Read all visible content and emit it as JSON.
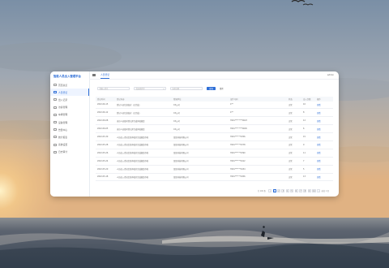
{
  "colors": {
    "accent": "#2f6fd7",
    "sky_top": "#7f94ab",
    "sky_glow": "#e7b47e",
    "sea": "#3a4a5a"
  },
  "app": {
    "logo": "智能人员出入管理平台",
    "user": "admin"
  },
  "sidebar": {
    "items": [
      {
        "label": "首页总览",
        "icon": "home-icon"
      },
      {
        "label": "人员登记",
        "icon": "user-icon"
      },
      {
        "label": "出入记录",
        "icon": "door-icon"
      },
      {
        "label": "访客管理",
        "icon": "visitor-icon"
      },
      {
        "label": "车辆管理",
        "icon": "car-icon"
      },
      {
        "label": "设备管理",
        "icon": "device-icon"
      },
      {
        "label": "告警中心",
        "icon": "alarm-icon"
      },
      {
        "label": "统计报表",
        "icon": "chart-icon"
      },
      {
        "label": "系统设置",
        "icon": "gear-icon"
      },
      {
        "label": "日志审计",
        "icon": "log-icon"
      }
    ],
    "active_index": 1
  },
  "header": {
    "tab": "人员登记"
  },
  "filters": {
    "name_placeholder": "请输入姓名",
    "type_placeholder": "请选择类型",
    "date_placeholder": "选择日期",
    "search_label": "查询",
    "reset_label": "重置"
  },
  "table": {
    "columns": [
      "登记时间",
      "登记内容",
      "所属单位",
      "证件号码",
      "状态",
      "出入次数",
      "操作"
    ],
    "rows": [
      [
        "2022-06-15",
        "登记人员信息核对（已完成）",
        "XX公司",
        "4**",
        "正常",
        "10",
        "查看"
      ],
      [
        "2022-06-12",
        "登记人员信息核对（已完成）",
        "XX公司",
        "4**",
        "正常",
        "8",
        "查看"
      ],
      [
        "2022-06-08",
        "来访人员临时登记并完成审核备案",
        "XX公司",
        "3501********0023",
        "正常",
        "12",
        "查看"
      ],
      [
        "2022-06-05",
        "来访人员临时登记并完成审核备案",
        "XX公司",
        "3501********0045",
        "正常",
        "6",
        "查看"
      ],
      [
        "2022-05-30",
        "人员出入登记信息审核并完成备案存档",
        "某某科技有限公司",
        "3501******2356",
        "正常",
        "15",
        "查看"
      ],
      [
        "2022-05-28",
        "人员出入登记信息审核并完成备案存档",
        "某某科技有限公司",
        "3501******2378",
        "正常",
        "9",
        "查看"
      ],
      [
        "2022-05-26",
        "人员出入登记信息审核并完成备案存档",
        "某某科技有限公司",
        "3501******2390",
        "正常",
        "11",
        "查看"
      ],
      [
        "2022-05-24",
        "人员出入登记信息审核并完成备案存档",
        "某某科技有限公司",
        "3501******2412",
        "正常",
        "7",
        "查看"
      ],
      [
        "2022-05-20",
        "人员出入登记信息审核并完成备案存档",
        "某某科技有限公司",
        "3501******2434",
        "正常",
        "5",
        "查看"
      ],
      [
        "2022-05-18",
        "人员出入登记信息审核并完成备案存档",
        "某某科技有限公司",
        "3501******2456",
        "正常",
        "13",
        "查看"
      ]
    ]
  },
  "pagination": {
    "total": "共 100 条",
    "prev": "‹",
    "pages": [
      "1",
      "2",
      "3",
      "4",
      "5",
      "6",
      "7",
      "8",
      "9",
      "10"
    ],
    "next": "›",
    "active": 0,
    "jump": "前往 1 页"
  }
}
